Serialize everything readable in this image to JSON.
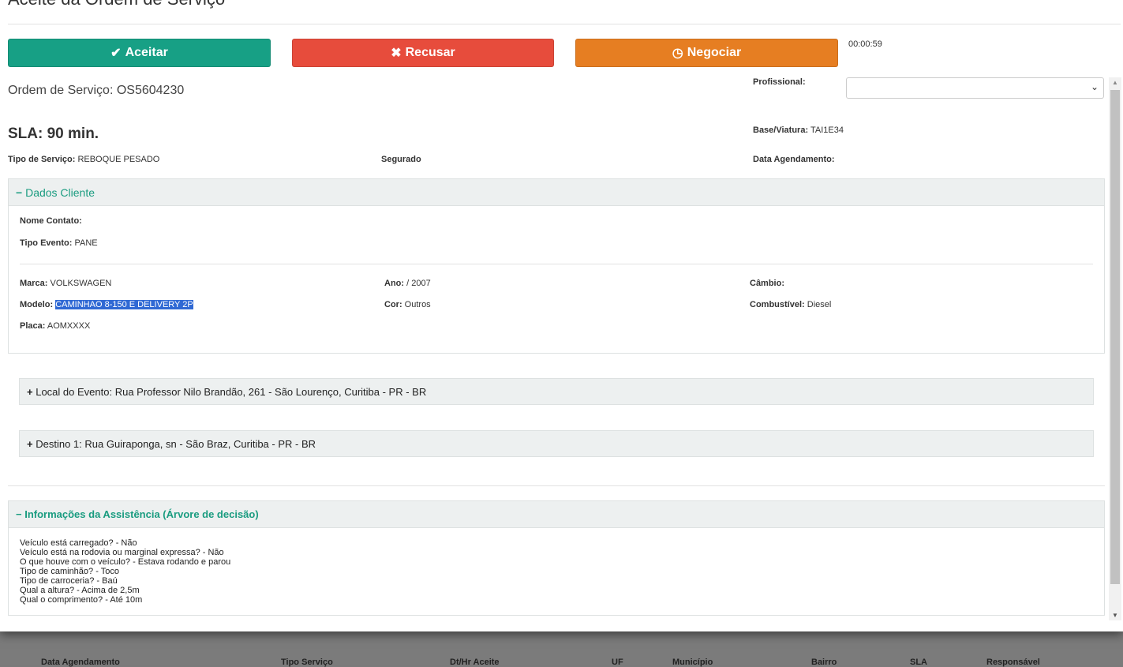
{
  "modal": {
    "title": "Aceite da Ordem de Serviço",
    "timer": "00:00:59"
  },
  "actions": {
    "accept": "Aceitar",
    "refuse": "Recusar",
    "negotiate": "Negociar"
  },
  "colors": {
    "accept": "#17a085",
    "refuse": "#e74c3c",
    "negotiate": "#e67e22",
    "section_title": "#1a9c80"
  },
  "order": {
    "label": "Ordem de Serviço:",
    "number": "OS5604230",
    "sla": "SLA: 90 min.",
    "service_type_label": "Tipo de Serviço:",
    "service_type": "REBOQUE PESADO",
    "insured_label": "Segurado",
    "professional_label": "Profissional:",
    "professional_value": "",
    "base_label": "Base/Viatura:",
    "base": "TAI1E34",
    "schedule_label": "Data Agendamento:"
  },
  "client": {
    "title": "Dados Cliente",
    "contact_label": "Nome Contato:",
    "event_type_label": "Tipo Evento:",
    "event_type": "PANE",
    "brand_label": "Marca:",
    "brand": "VOLKSWAGEN",
    "year_label": "Ano:",
    "year": "/ 2007",
    "gearbox_label": "Câmbio:",
    "model_label": "Modelo:",
    "model": "CAMINHAO 8-150 E DELIVERY 2P",
    "color_label": "Cor:",
    "color": "Outros",
    "fuel_label": "Combustível:",
    "fuel": "Diesel",
    "plate_label": "Placa:",
    "plate": "AOMXXXX"
  },
  "locations": {
    "event_label": "Local do Evento:",
    "event": "Rua Professor Nilo Brandão, 261 - São Lourenço, Curitiba - PR - BR",
    "dest_label": "Destino 1:",
    "dest": "Rua Guiraponga, sn - São Braz, Curitiba - PR - BR"
  },
  "assistance": {
    "title": "Informações da Assistência (Árvore de decisão)",
    "lines": [
      "Veículo está carregado? - Não",
      "Veículo está na rodovia ou marginal expressa? - Não",
      "O que houve com o veículo? - Estava rodando e parou",
      "Tipo de caminhão? - Toco",
      "Tipo de carroceria? - Baú",
      "Qual a altura? - Acima de 2,5m",
      "Qual o comprimento? - Até 10m"
    ]
  },
  "background_table": {
    "headers": [
      "Data Agendamento",
      "Tipo Serviço",
      "Dt/Hr Aceite",
      "UF",
      "Município",
      "Bairro",
      "SLA",
      "Responsável"
    ]
  }
}
